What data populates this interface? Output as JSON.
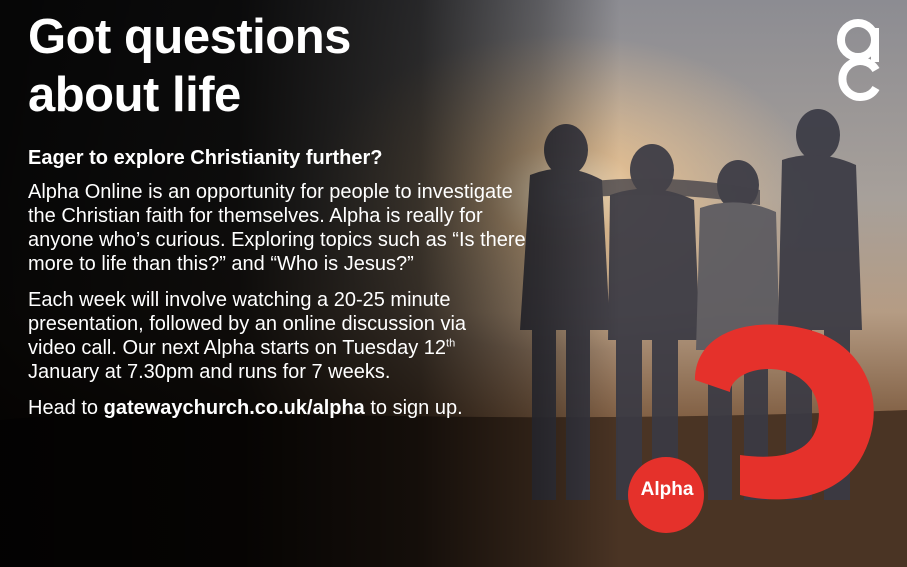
{
  "headline": {
    "line1": "Got questions",
    "line2": "about life"
  },
  "subheading": "Eager to explore Christianity further?",
  "paragraph1": "Alpha Online is an opportunity for people to investigate the Christian faith for themselves. Alpha is really for anyone who’s curious. Exploring topics such as “Is there more to life than this?” and “Who is Jesus?”",
  "paragraph2": {
    "before_date": "Each week will involve watching a 20-25 minute presentation, followed by an online discussion via video call. Our next Alpha starts on Tuesday 12",
    "date_suffix": "th",
    "after_date": " January at 7.30pm and runs for 7 weeks."
  },
  "cta": {
    "prefix": "Head to ",
    "link": "gatewaychurch.co.uk/alpha",
    "suffix": " to sign up."
  },
  "alpha_logo": {
    "label": "Alpha",
    "color": "#e5312b",
    "icon": "alpha-question-mark-icon"
  },
  "church_logo": {
    "icon": "gc-monogram-icon",
    "color": "#ffffff"
  },
  "colors": {
    "text": "#ffffff",
    "background": "#000000",
    "accent": "#e5312b"
  }
}
